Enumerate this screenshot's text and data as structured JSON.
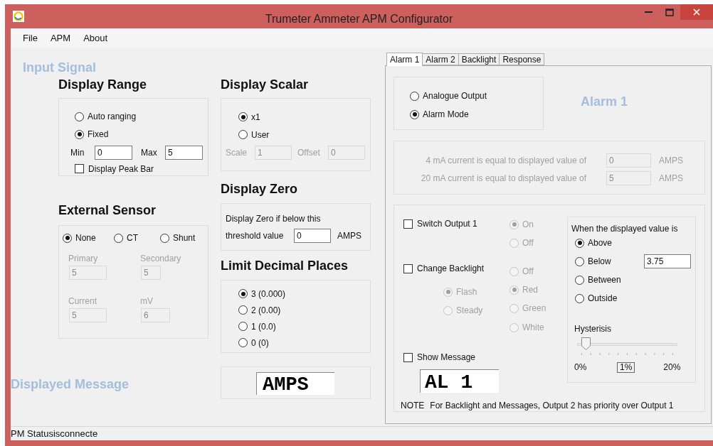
{
  "window": {
    "title": "Trumeter Ammeter APM Configurator"
  },
  "menu": [
    {
      "label": "File"
    },
    {
      "label": "APM"
    },
    {
      "label": "About"
    }
  ],
  "input_signal": {
    "heading": "Input Signal"
  },
  "display_range": {
    "title": "Display Range",
    "options": [
      {
        "label": "Auto ranging",
        "selected": false
      },
      {
        "label": "Fixed",
        "selected": true
      }
    ],
    "fields": [
      {
        "label": "Min",
        "value": "0",
        "disabled": false
      },
      {
        "label": "Max",
        "value": "5",
        "disabled": false
      }
    ],
    "peak_bar": {
      "label": "Display Peak Bar",
      "checked": false
    }
  },
  "external_sensor": {
    "title": "External Sensor",
    "options": [
      {
        "label": "None",
        "selected": true
      },
      {
        "label": "CT",
        "selected": false
      },
      {
        "label": "Shunt",
        "selected": false
      }
    ],
    "fields": [
      {
        "label": "Primary",
        "value": "5",
        "disabled": true
      },
      {
        "label": "Secondary",
        "value": "5",
        "disabled": true
      },
      {
        "label": "Current",
        "value": "5",
        "disabled": true
      },
      {
        "label": "mV",
        "value": "6",
        "disabled": true
      }
    ]
  },
  "display_scalar": {
    "title": "Display Scalar",
    "options": [
      {
        "label": "x1",
        "selected": true
      },
      {
        "label": "User",
        "selected": false
      }
    ],
    "fields": [
      {
        "label": "Scale",
        "value": "1",
        "disabled": true
      },
      {
        "label": "Offset",
        "value": "0",
        "disabled": true
      }
    ]
  },
  "display_zero": {
    "title": "Display Zero",
    "text": "Display Zero if below this",
    "field": {
      "label": "threshold value",
      "value": "0",
      "disabled": false
    },
    "unit": "AMPS"
  },
  "decimal_places": {
    "title": "Limit Decimal Places",
    "options": [
      {
        "label": "3 (0.000)",
        "selected": true
      },
      {
        "label": "2 (0.00)",
        "selected": false
      },
      {
        "label": "1 (0.0)",
        "selected": false
      },
      {
        "label": "0 (0)",
        "selected": false
      }
    ]
  },
  "displayed_message": {
    "heading": "Displayed Message",
    "value": "AMPS"
  },
  "tabs": [
    {
      "label": "Alarm 1",
      "selected": true
    },
    {
      "label": "Alarm 2",
      "selected": false
    },
    {
      "label": "Backlight",
      "selected": false
    },
    {
      "label": "Response",
      "selected": false
    }
  ],
  "alarm": {
    "title": "Alarm 1",
    "modes": [
      {
        "label": "Analogue Output",
        "selected": false
      },
      {
        "label": "Alarm Mode",
        "selected": true
      }
    ],
    "analogue": {
      "disabled": true,
      "rows": [
        {
          "label": "4 mA current is equal to displayed value of",
          "value": "0",
          "unit": "AMPS"
        },
        {
          "label": "20 mA current is equal to displayed value of",
          "value": "5",
          "unit": "AMPS"
        }
      ]
    },
    "switch_output": {
      "label": "Switch Output 1",
      "checked": false,
      "disabled": true,
      "options": [
        {
          "label": "On",
          "selected": true
        },
        {
          "label": "Off",
          "selected": false
        }
      ]
    },
    "change_backlight": {
      "label": "Change Backlight",
      "checked": false,
      "disabled": true,
      "modes": [
        {
          "label": "Flash",
          "selected": true
        },
        {
          "label": "Steady",
          "selected": false
        }
      ],
      "colors": [
        {
          "label": "Off",
          "selected": false
        },
        {
          "label": "Red",
          "selected": true
        },
        {
          "label": "Green",
          "selected": false
        },
        {
          "label": "White",
          "selected": false
        }
      ]
    },
    "show_message": {
      "label": "Show Message",
      "checked": false,
      "value": "AL 1"
    },
    "condition": {
      "title": "When the displayed value is",
      "options": [
        {
          "label": "Above",
          "selected": true
        },
        {
          "label": "Below",
          "selected": false
        },
        {
          "label": "Between",
          "selected": false
        },
        {
          "label": "Outside",
          "selected": false
        }
      ],
      "value": "3.75"
    },
    "hysteresis": {
      "label": "Hysterisis",
      "level": 0.05,
      "min_label": "0%",
      "value": "1%",
      "max_label": "20%"
    },
    "note_label": "NOTE",
    "note": "For Backlight and Messages, Output 2 has priority over Output 1"
  },
  "status_bar": {
    "text": "PM Statusisconnecte"
  }
}
